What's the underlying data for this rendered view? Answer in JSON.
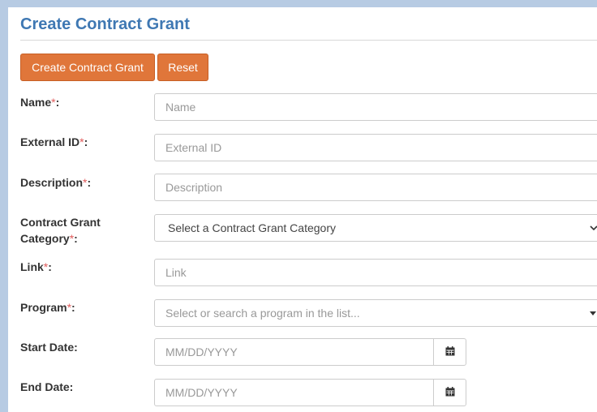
{
  "title": "Create Contract Grant",
  "buttons": {
    "create_label": "Create Contract Grant",
    "reset_label": "Reset"
  },
  "fields": {
    "name": {
      "label": "Name",
      "required_mark": "*",
      "suffix": ":",
      "placeholder": "Name"
    },
    "external_id": {
      "label": "External ID",
      "required_mark": "*",
      "suffix": ":",
      "placeholder": "External ID"
    },
    "description": {
      "label": "Description",
      "required_mark": "*",
      "suffix": ":",
      "placeholder": "Description"
    },
    "category": {
      "label_line1": "Contract Grant",
      "label_line2": "Category",
      "required_mark": "*",
      "suffix": ":",
      "selected": "Select a Contract Grant Category"
    },
    "link": {
      "label": "Link",
      "required_mark": "*",
      "suffix": ":",
      "placeholder": "Link"
    },
    "program": {
      "label": "Program",
      "required_mark": "*",
      "suffix": ":",
      "placeholder": "Select or search a program in the list..."
    },
    "start_date": {
      "label": "Start Date:",
      "placeholder": "MM/DD/YYYY"
    },
    "end_date": {
      "label": "End Date:",
      "placeholder": "MM/DD/YYYY"
    }
  },
  "icons": {
    "calendar": "calendar-icon",
    "chevron": "chevron-down-icon",
    "caret": "caret-down-icon"
  }
}
